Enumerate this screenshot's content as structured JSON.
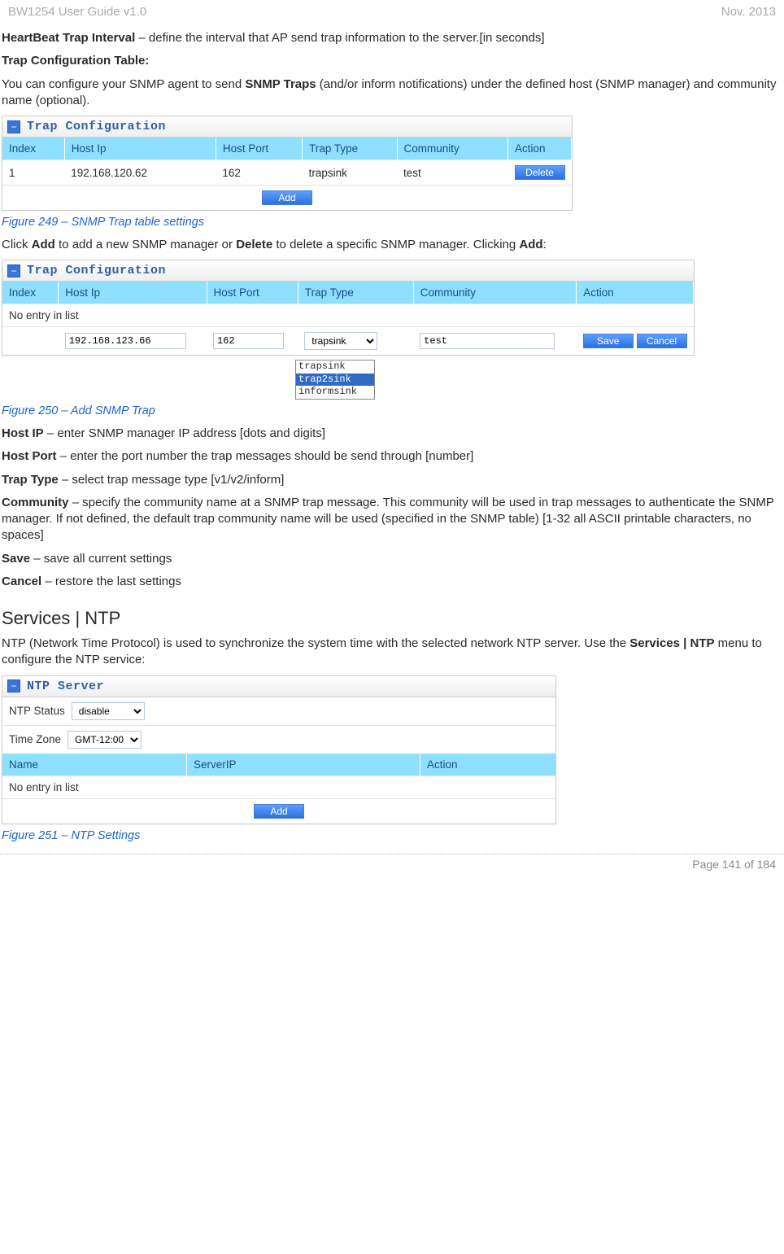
{
  "header": {
    "doc_title": "BW1254 User Guide v1.0",
    "doc_date": "Nov.  2013"
  },
  "body": {
    "p1_label": "HeartBeat Trap Interval",
    "p1_rest": " – define the interval that AP send trap information to the server.[in seconds]",
    "p2_label": "Trap Configuration Table:",
    "p3_part1": "You can configure your SNMP agent to send ",
    "p3_bold": "SNMP Traps",
    "p3_part2": " (and/or inform notifications) under the defined host (SNMP manager) and community name (optional).",
    "trap1": {
      "title": "Trap Configuration",
      "headers": [
        "Index",
        "Host Ip",
        "Host Port",
        "Trap Type",
        "Community",
        "Action"
      ],
      "row": {
        "index": "1",
        "hostip": "192.168.120.62",
        "hostport": "162",
        "traptype": "trapsink",
        "community": "test"
      },
      "btn_delete": "Delete",
      "btn_add": "Add"
    },
    "fig249": "Figure 249 – SNMP Trap table settings",
    "p4_a": "Click ",
    "p4_b": "Add",
    "p4_c": " to add a new SNMP manager or ",
    "p4_d": "Delete",
    "p4_e": " to delete a specific SNMP manager. Clicking ",
    "p4_f": "Add",
    "p4_g": ":",
    "trap2": {
      "title": "Trap Configuration",
      "headers": [
        "Index",
        "Host Ip",
        "Host Port",
        "Trap Type",
        "Community",
        "Action"
      ],
      "noentry": "No entry in list",
      "hostip_val": "192.168.123.66",
      "hostport_val": "162",
      "traptype_val": "trapsink",
      "community_val": "test",
      "btn_save": "Save",
      "btn_cancel": "Cancel",
      "options": [
        "trapsink",
        "trap2sink",
        "informsink"
      ]
    },
    "fig250": "Figure 250 – Add SNMP Trap",
    "hostip_lbl": "Host IP",
    "hostip_txt": " – enter SNMP manager IP address [dots and digits]",
    "hostport_lbl": "Host Port",
    "hostport_txt": " – enter the port number the trap messages should be send through [number]",
    "traptype_lbl": "Trap Type",
    "traptype_txt": " – select trap message type [v1/v2/inform]",
    "community_lbl": "Community",
    "community_txt": " – specify the community name at a SNMP trap message. This community will be used in trap messages to authenticate the SNMP manager. If not defined, the default trap community name will be used (specified in the SNMP table) [1-32 all ASCII printable characters, no spaces]",
    "save_lbl": "Save",
    "save_txt": " – save all current settings",
    "cancel_lbl": "Cancel",
    "cancel_txt": " – restore the last settings",
    "ntp_heading": "Services | NTP",
    "ntp_intro_a": "NTP (Network Time Protocol) is used to synchronize the system time with the selected network NTP server. Use the ",
    "ntp_intro_b": "Services | NTP",
    "ntp_intro_c": " menu to configure the NTP service:",
    "ntp": {
      "title": "NTP Server",
      "status_label": "NTP Status",
      "status_val": "disable",
      "tz_label": "Time Zone",
      "tz_val": "GMT-12:00",
      "headers": [
        "Name",
        "ServerIP",
        "Action"
      ],
      "noentry": "No entry in list",
      "btn_add": "Add"
    },
    "fig251": "Figure 251 – NTP Settings"
  },
  "footer": {
    "page_text": "Page 141 of 184"
  }
}
